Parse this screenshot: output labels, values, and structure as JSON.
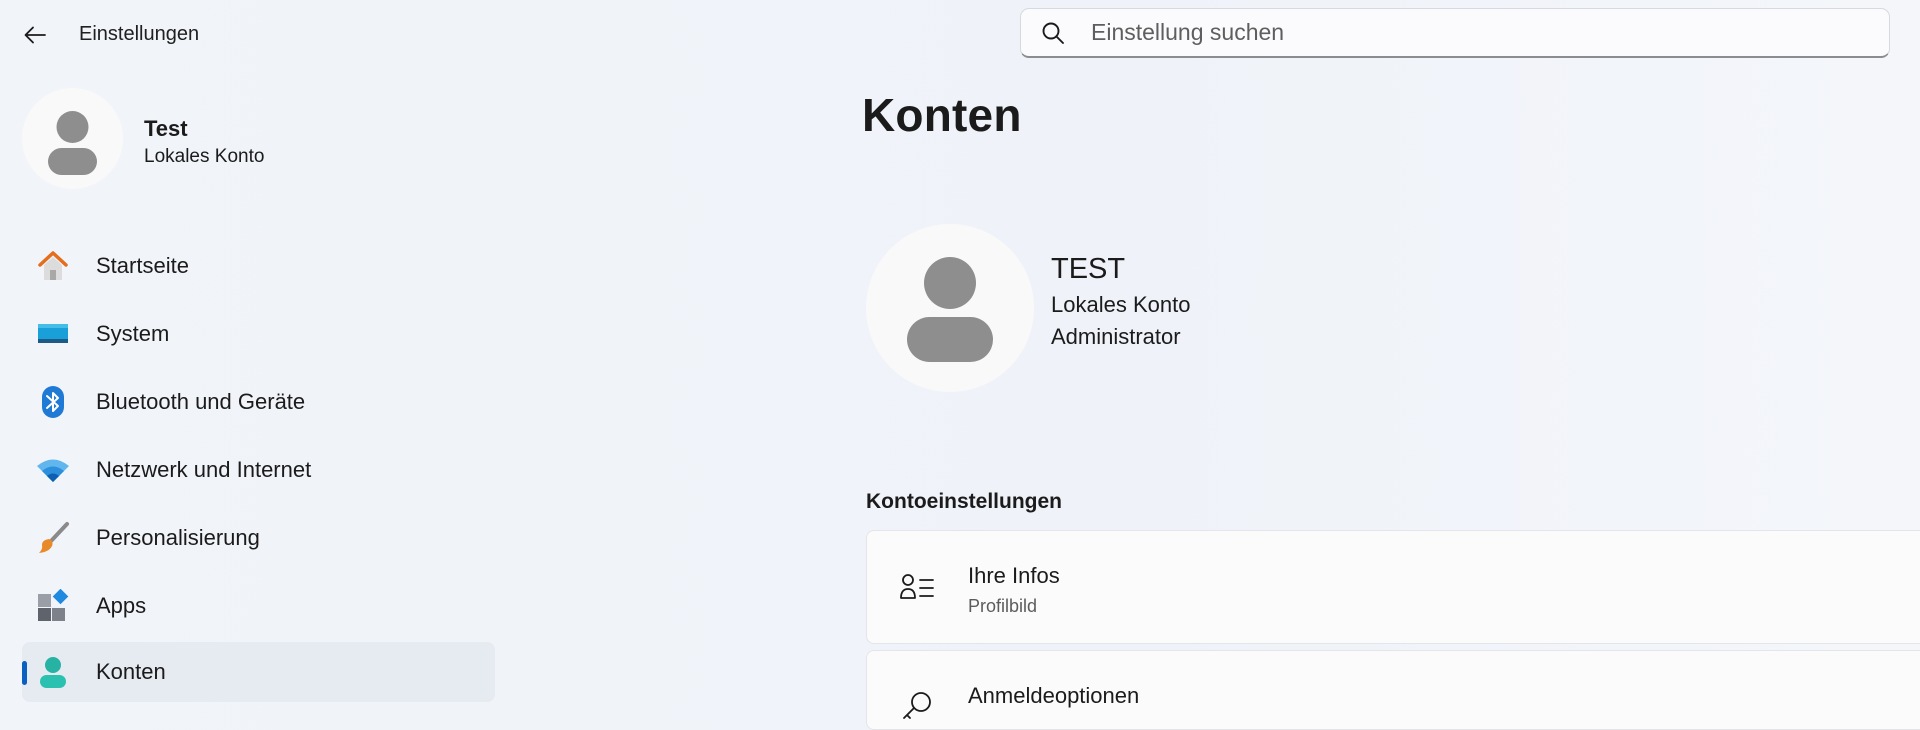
{
  "window": {
    "app_title": "Einstellungen",
    "back_icon": "back-arrow-icon"
  },
  "search": {
    "placeholder": "Einstellung suchen",
    "value": "",
    "icon": "search-icon"
  },
  "sidebar": {
    "profile": {
      "name": "Test",
      "account_type": "Lokales Konto"
    },
    "items": [
      {
        "label": "Startseite",
        "icon": "home-icon"
      },
      {
        "label": "System",
        "icon": "system-display-icon"
      },
      {
        "label": "Bluetooth und Geräte",
        "icon": "bluetooth-icon"
      },
      {
        "label": "Netzwerk und Internet",
        "icon": "wifi-icon"
      },
      {
        "label": "Personalisierung",
        "icon": "paintbrush-icon"
      },
      {
        "label": "Apps",
        "icon": "apps-icon"
      },
      {
        "label": "Konten",
        "icon": "accounts-icon",
        "selected": true
      }
    ]
  },
  "main": {
    "title": "Konten",
    "account": {
      "name": "TEST",
      "type": "Lokales Konto",
      "role": "Administrator"
    },
    "section_title": "Kontoeinstellungen",
    "cards": [
      {
        "title": "Ihre Infos",
        "subtitle": "Profilbild",
        "icon": "person-info-icon"
      },
      {
        "title": "Anmeldeoptionen",
        "subtitle": "",
        "icon": "key-icon"
      }
    ]
  },
  "colors": {
    "accent": "#0a5fc2",
    "selected_bg": "#e6eaf1",
    "avatar_gray": "#8e8e8e"
  }
}
